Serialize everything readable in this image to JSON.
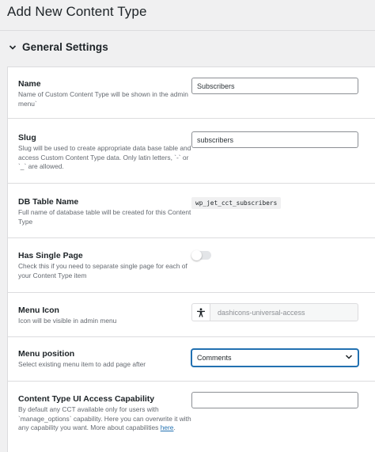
{
  "page": {
    "title": "Add New Content Type"
  },
  "section": {
    "title": "General Settings",
    "chevron_icon": "chevron-down-icon"
  },
  "fields": {
    "name": {
      "label": "Name",
      "description": "Name of Custom Content Type will be shown in the admin menu`",
      "value": "Subscribers"
    },
    "slug": {
      "label": "Slug",
      "description": "Slug will be used to create appropriate data base table and access Custom Content Type data. Only latin letters, `-` or `_` are allowed.",
      "value": "subscribers"
    },
    "db_table": {
      "label": "DB Table Name",
      "description": "Full name of database table will be created for this Content Type",
      "value": "wp_jet_cct_subscribers"
    },
    "single_page": {
      "label": "Has Single Page",
      "description": "Check this if you need to separate single page for each of your Content Type item",
      "enabled": false
    },
    "menu_icon": {
      "label": "Menu Icon",
      "description": "Icon will be visible in admin menu",
      "icon": "universal-access-icon",
      "value": "dashicons-universal-access"
    },
    "menu_position": {
      "label": "Menu position",
      "description": "Select existing menu item to add page after",
      "selected": "Comments"
    },
    "capability": {
      "label": "Content Type UI Access Capability",
      "description": "By default any CCT available only for users with `manage_options` capability. Here you can overwrite it with any capability you want. More about capabilities ",
      "link_text": "here",
      "value": ""
    }
  },
  "colors": {
    "link": "#2271b1",
    "background": "#f0f0f1",
    "border": "#dcdcde"
  }
}
